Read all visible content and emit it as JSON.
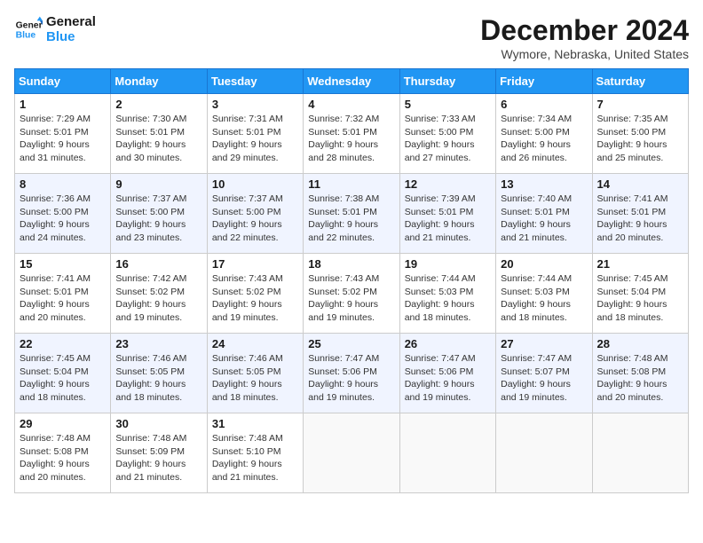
{
  "logo": {
    "text_general": "General",
    "text_blue": "Blue"
  },
  "title": "December 2024",
  "subtitle": "Wymore, Nebraska, United States",
  "days_of_week": [
    "Sunday",
    "Monday",
    "Tuesday",
    "Wednesday",
    "Thursday",
    "Friday",
    "Saturday"
  ],
  "weeks": [
    [
      {
        "day": "1",
        "sunrise": "7:29 AM",
        "sunset": "5:01 PM",
        "daylight": "9 hours and 31 minutes."
      },
      {
        "day": "2",
        "sunrise": "7:30 AM",
        "sunset": "5:01 PM",
        "daylight": "9 hours and 30 minutes."
      },
      {
        "day": "3",
        "sunrise": "7:31 AM",
        "sunset": "5:01 PM",
        "daylight": "9 hours and 29 minutes."
      },
      {
        "day": "4",
        "sunrise": "7:32 AM",
        "sunset": "5:01 PM",
        "daylight": "9 hours and 28 minutes."
      },
      {
        "day": "5",
        "sunrise": "7:33 AM",
        "sunset": "5:00 PM",
        "daylight": "9 hours and 27 minutes."
      },
      {
        "day": "6",
        "sunrise": "7:34 AM",
        "sunset": "5:00 PM",
        "daylight": "9 hours and 26 minutes."
      },
      {
        "day": "7",
        "sunrise": "7:35 AM",
        "sunset": "5:00 PM",
        "daylight": "9 hours and 25 minutes."
      }
    ],
    [
      {
        "day": "8",
        "sunrise": "7:36 AM",
        "sunset": "5:00 PM",
        "daylight": "9 hours and 24 minutes."
      },
      {
        "day": "9",
        "sunrise": "7:37 AM",
        "sunset": "5:00 PM",
        "daylight": "9 hours and 23 minutes."
      },
      {
        "day": "10",
        "sunrise": "7:37 AM",
        "sunset": "5:00 PM",
        "daylight": "9 hours and 22 minutes."
      },
      {
        "day": "11",
        "sunrise": "7:38 AM",
        "sunset": "5:01 PM",
        "daylight": "9 hours and 22 minutes."
      },
      {
        "day": "12",
        "sunrise": "7:39 AM",
        "sunset": "5:01 PM",
        "daylight": "9 hours and 21 minutes."
      },
      {
        "day": "13",
        "sunrise": "7:40 AM",
        "sunset": "5:01 PM",
        "daylight": "9 hours and 21 minutes."
      },
      {
        "day": "14",
        "sunrise": "7:41 AM",
        "sunset": "5:01 PM",
        "daylight": "9 hours and 20 minutes."
      }
    ],
    [
      {
        "day": "15",
        "sunrise": "7:41 AM",
        "sunset": "5:01 PM",
        "daylight": "9 hours and 20 minutes."
      },
      {
        "day": "16",
        "sunrise": "7:42 AM",
        "sunset": "5:02 PM",
        "daylight": "9 hours and 19 minutes."
      },
      {
        "day": "17",
        "sunrise": "7:43 AM",
        "sunset": "5:02 PM",
        "daylight": "9 hours and 19 minutes."
      },
      {
        "day": "18",
        "sunrise": "7:43 AM",
        "sunset": "5:02 PM",
        "daylight": "9 hours and 19 minutes."
      },
      {
        "day": "19",
        "sunrise": "7:44 AM",
        "sunset": "5:03 PM",
        "daylight": "9 hours and 18 minutes."
      },
      {
        "day": "20",
        "sunrise": "7:44 AM",
        "sunset": "5:03 PM",
        "daylight": "9 hours and 18 minutes."
      },
      {
        "day": "21",
        "sunrise": "7:45 AM",
        "sunset": "5:04 PM",
        "daylight": "9 hours and 18 minutes."
      }
    ],
    [
      {
        "day": "22",
        "sunrise": "7:45 AM",
        "sunset": "5:04 PM",
        "daylight": "9 hours and 18 minutes."
      },
      {
        "day": "23",
        "sunrise": "7:46 AM",
        "sunset": "5:05 PM",
        "daylight": "9 hours and 18 minutes."
      },
      {
        "day": "24",
        "sunrise": "7:46 AM",
        "sunset": "5:05 PM",
        "daylight": "9 hours and 18 minutes."
      },
      {
        "day": "25",
        "sunrise": "7:47 AM",
        "sunset": "5:06 PM",
        "daylight": "9 hours and 19 minutes."
      },
      {
        "day": "26",
        "sunrise": "7:47 AM",
        "sunset": "5:06 PM",
        "daylight": "9 hours and 19 minutes."
      },
      {
        "day": "27",
        "sunrise": "7:47 AM",
        "sunset": "5:07 PM",
        "daylight": "9 hours and 19 minutes."
      },
      {
        "day": "28",
        "sunrise": "7:48 AM",
        "sunset": "5:08 PM",
        "daylight": "9 hours and 20 minutes."
      }
    ],
    [
      {
        "day": "29",
        "sunrise": "7:48 AM",
        "sunset": "5:08 PM",
        "daylight": "9 hours and 20 minutes."
      },
      {
        "day": "30",
        "sunrise": "7:48 AM",
        "sunset": "5:09 PM",
        "daylight": "9 hours and 21 minutes."
      },
      {
        "day": "31",
        "sunrise": "7:48 AM",
        "sunset": "5:10 PM",
        "daylight": "9 hours and 21 minutes."
      },
      null,
      null,
      null,
      null
    ]
  ]
}
